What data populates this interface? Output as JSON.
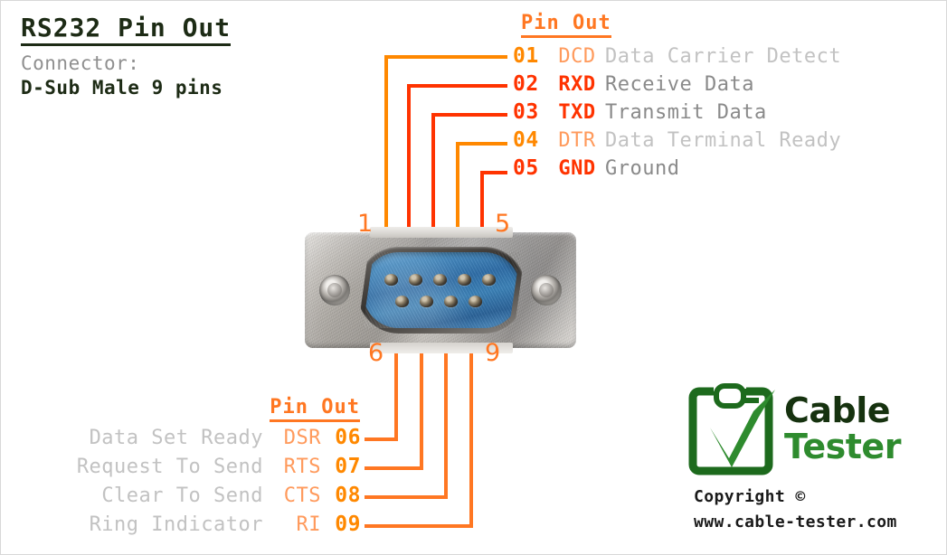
{
  "document": {
    "title": "RS232 Pin Out",
    "connector_label": "Connector:",
    "connector_value": "D-Sub Male 9 pins"
  },
  "colors": {
    "accent_orange": "#FF7722",
    "accent_red": "#FF3300",
    "accent_light_orange": "#FF9A5C",
    "number_orange": "#FF8800",
    "desc_dark_gray": "#8A8A8A",
    "desc_light_gray": "#C2C2C2",
    "title_dark": "#1D2B15",
    "logo_green_dark": "#16320F",
    "logo_green": "#2E8B2E"
  },
  "pinout_top": {
    "header": "Pin Out",
    "rows": [
      {
        "number": "01",
        "signal": "DCD",
        "description": "Data Carrier Detect",
        "emphasis": "low"
      },
      {
        "number": "02",
        "signal": "RXD",
        "description": "Receive  Data",
        "emphasis": "high"
      },
      {
        "number": "03",
        "signal": "TXD",
        "description": "Transmit Data",
        "emphasis": "high"
      },
      {
        "number": "04",
        "signal": "DTR",
        "description": "Data Terminal Ready",
        "emphasis": "low"
      },
      {
        "number": "05",
        "signal": "GND",
        "description": "Ground",
        "emphasis": "high"
      }
    ]
  },
  "pinout_bottom": {
    "header": "Pin Out",
    "rows": [
      {
        "number": "06",
        "signal": "DSR",
        "description": "Data Set Ready",
        "emphasis": "low"
      },
      {
        "number": "07",
        "signal": "RTS",
        "description": "Request To Send",
        "emphasis": "low"
      },
      {
        "number": "08",
        "signal": "CTS",
        "description": "Clear To Send",
        "emphasis": "low"
      },
      {
        "number": "09",
        "signal": "RI",
        "description": "Ring Indicator",
        "emphasis": "low"
      }
    ]
  },
  "connector_image": {
    "pin_index_top_left": "1",
    "pin_index_top_right": "5",
    "pin_index_bottom_left": "6",
    "pin_index_bottom_right": "9",
    "shell": "D-Sub DE-9 male metal flange",
    "insert_color": "blue"
  },
  "logo": {
    "word_1": "Cable",
    "word_2": "Tester",
    "copyright": "Copyright ©",
    "website": "www.cable-tester.com"
  }
}
